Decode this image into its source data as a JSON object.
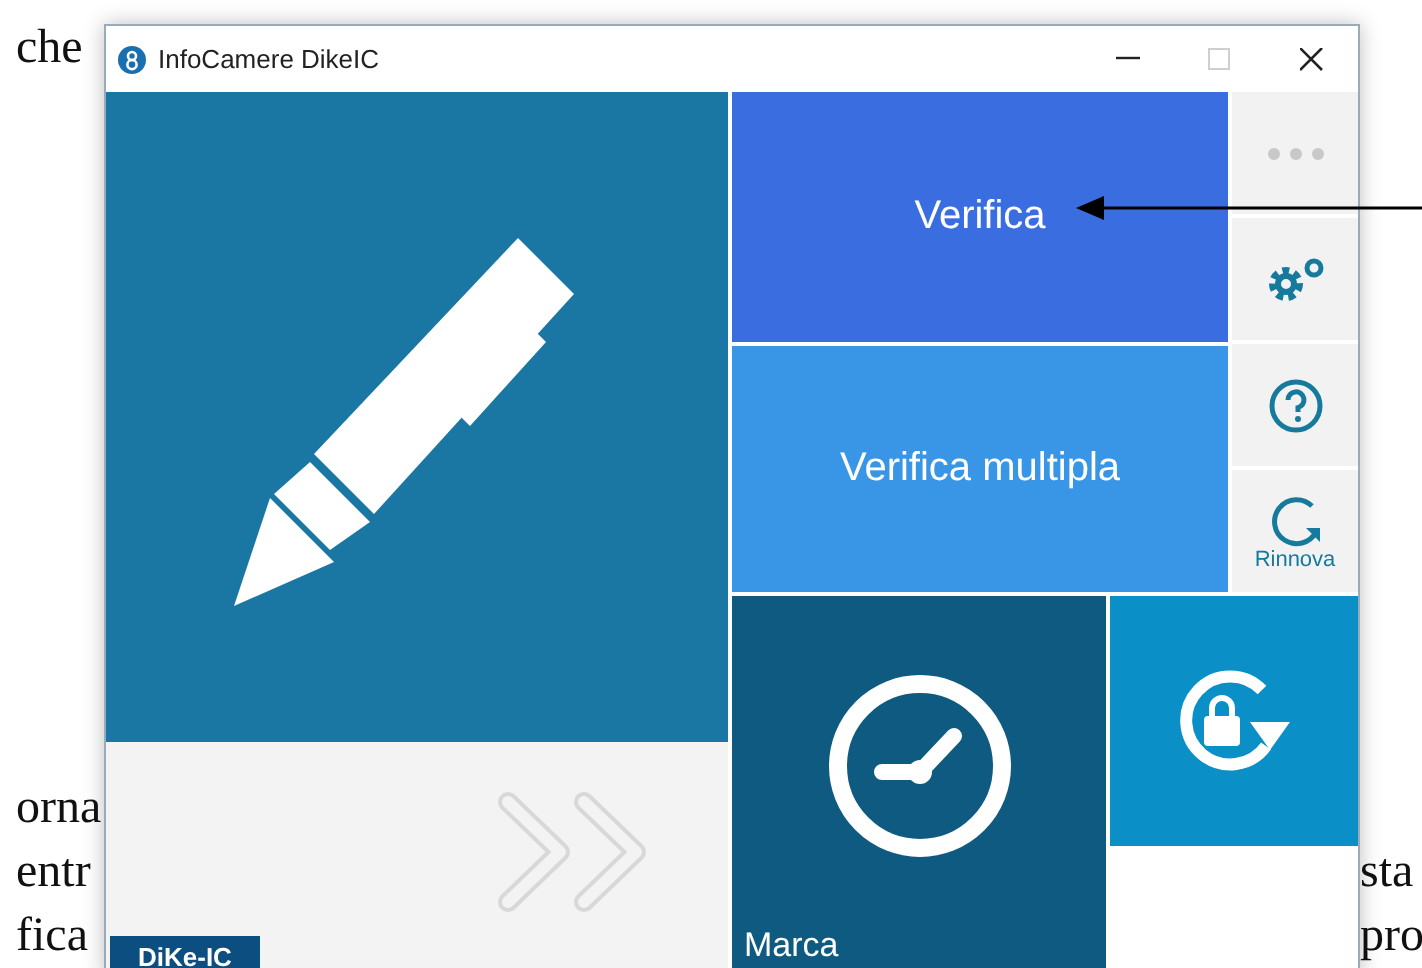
{
  "document": {
    "left_fragments": [
      "che",
      "orna",
      "entr",
      "fica"
    ],
    "right_fragments": [
      "sta",
      "pro"
    ]
  },
  "window": {
    "title": "InfoCamere DikeIC",
    "controls": [
      {
        "kind": "minimize",
        "disabled": false
      },
      {
        "kind": "maximize",
        "disabled": true
      },
      {
        "kind": "close",
        "disabled": false
      }
    ]
  },
  "badge": "DiKe-IC",
  "verify_button": {
    "label": "Verifica"
  },
  "verify_multiple_button": {
    "label": "Verifica multipla"
  },
  "side_buttons": [
    {
      "kind": "more"
    },
    {
      "kind": "settings"
    },
    {
      "kind": "help"
    },
    {
      "kind": "renew",
      "label": "Rinnova"
    }
  ],
  "timestamp_tile": {
    "label": "Marca"
  },
  "annotation": {
    "kind": "arrow"
  }
}
